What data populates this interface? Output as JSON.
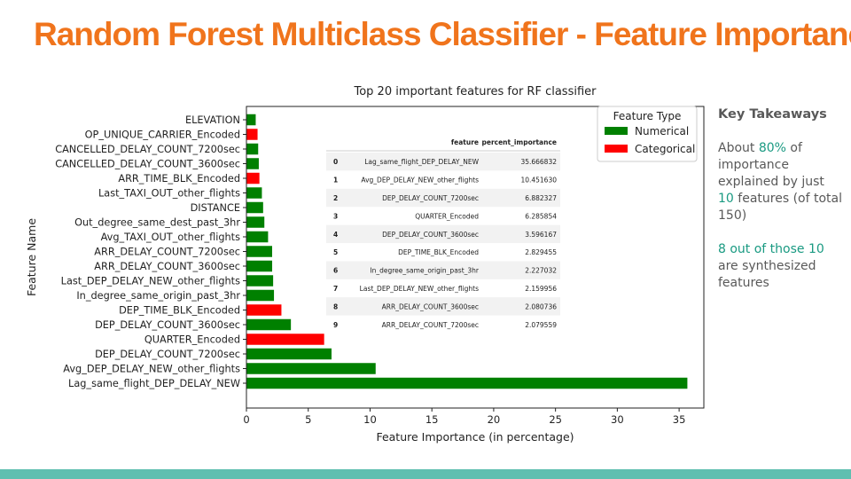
{
  "slide": {
    "title": "Random Forest Multiclass Classifier - Feature Importance"
  },
  "takeaways": {
    "heading": "Key Takeaways",
    "p1": {
      "t1": "About ",
      "pct": "80%",
      "t2": " of importance explained by just ",
      "count": "10",
      "t3": " features (of total 150)"
    },
    "p2": {
      "hl": "8 out of those 10",
      "t1": " are synthesized features"
    }
  },
  "colors": {
    "title": "#f0741c",
    "numerical": "#008000",
    "categorical": "#ff0000",
    "highlight": "#1a9a82",
    "footer": "#5fbfb0"
  },
  "chart_data": {
    "type": "bar",
    "orientation": "horizontal",
    "title": "Top 20 important features for RF classifier",
    "xlabel": "Feature Importance (in percentage)",
    "ylabel": "Feature Name",
    "xlim": [
      0,
      37
    ],
    "xticks": [
      0,
      5,
      10,
      15,
      20,
      25,
      30,
      35
    ],
    "legend": {
      "title": "Feature Type",
      "placement": "top-right",
      "entries": [
        {
          "label": "Numerical",
          "type": "Numerical"
        },
        {
          "label": "Categorical",
          "type": "Categorical"
        }
      ]
    },
    "bars": [
      {
        "feature": "ELEVATION",
        "value": 0.75,
        "type": "Numerical"
      },
      {
        "feature": "OP_UNIQUE_CARRIER_Encoded",
        "value": 0.9,
        "type": "Categorical"
      },
      {
        "feature": "CANCELLED_DELAY_COUNT_7200sec",
        "value": 0.95,
        "type": "Numerical"
      },
      {
        "feature": "CANCELLED_DELAY_COUNT_3600sec",
        "value": 1.0,
        "type": "Numerical"
      },
      {
        "feature": "ARR_TIME_BLK_Encoded",
        "value": 1.05,
        "type": "Categorical"
      },
      {
        "feature": "Last_TAXI_OUT_other_flights",
        "value": 1.25,
        "type": "Numerical"
      },
      {
        "feature": "DISTANCE",
        "value": 1.35,
        "type": "Numerical"
      },
      {
        "feature": "Out_degree_same_dest_past_3hr",
        "value": 1.45,
        "type": "Numerical"
      },
      {
        "feature": "Avg_TAXI_OUT_other_flights",
        "value": 1.75,
        "type": "Numerical"
      },
      {
        "feature": "ARR_DELAY_COUNT_7200sec",
        "value": 2.079559,
        "type": "Numerical"
      },
      {
        "feature": "ARR_DELAY_COUNT_3600sec",
        "value": 2.080736,
        "type": "Numerical"
      },
      {
        "feature": "Last_DEP_DELAY_NEW_other_flights",
        "value": 2.159956,
        "type": "Numerical"
      },
      {
        "feature": "In_degree_same_origin_past_3hr",
        "value": 2.227032,
        "type": "Numerical"
      },
      {
        "feature": "DEP_TIME_BLK_Encoded",
        "value": 2.829455,
        "type": "Categorical"
      },
      {
        "feature": "DEP_DELAY_COUNT_3600sec",
        "value": 3.596167,
        "type": "Numerical"
      },
      {
        "feature": "QUARTER_Encoded",
        "value": 6.285854,
        "type": "Categorical"
      },
      {
        "feature": "DEP_DELAY_COUNT_7200sec",
        "value": 6.882327,
        "type": "Numerical"
      },
      {
        "feature": "Avg_DEP_DELAY_NEW_other_flights",
        "value": 10.45163,
        "type": "Numerical"
      },
      {
        "feature": "Lag_same_flight_DEP_DELAY_NEW",
        "value": 35.666832,
        "type": "Numerical"
      }
    ],
    "table": {
      "columns": [
        "",
        "feature",
        "percent_importance"
      ],
      "rows": [
        [
          "0",
          "Lag_same_flight_DEP_DELAY_NEW",
          "35.666832"
        ],
        [
          "1",
          "Avg_DEP_DELAY_NEW_other_flights",
          "10.451630"
        ],
        [
          "2",
          "DEP_DELAY_COUNT_7200sec",
          "6.882327"
        ],
        [
          "3",
          "QUARTER_Encoded",
          "6.285854"
        ],
        [
          "4",
          "DEP_DELAY_COUNT_3600sec",
          "3.596167"
        ],
        [
          "5",
          "DEP_TIME_BLK_Encoded",
          "2.829455"
        ],
        [
          "6",
          "In_degree_same_origin_past_3hr",
          "2.227032"
        ],
        [
          "7",
          "Last_DEP_DELAY_NEW_other_flights",
          "2.159956"
        ],
        [
          "8",
          "ARR_DELAY_COUNT_3600sec",
          "2.080736"
        ],
        [
          "9",
          "ARR_DELAY_COUNT_7200sec",
          "2.079559"
        ]
      ]
    }
  }
}
